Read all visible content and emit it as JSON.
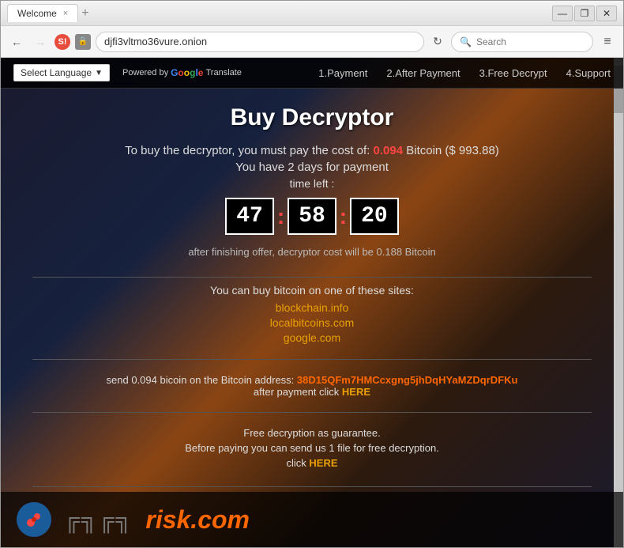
{
  "window": {
    "title": "Welcome",
    "tab_close": "×",
    "tab_new": "+",
    "url": "djfi3vltmo36vure.onion",
    "btn_min": "—",
    "btn_restore": "❐",
    "btn_close": "✕",
    "menu_icon": "≡"
  },
  "search": {
    "placeholder": "Search"
  },
  "nav": {
    "language_label": "Select Language",
    "powered_text": "Powered by",
    "translate_text": "Translate",
    "links": [
      {
        "label": "1.Payment"
      },
      {
        "label": "2.After Payment"
      },
      {
        "label": "3.Free Decrypt"
      },
      {
        "label": "4.Support"
      }
    ]
  },
  "main": {
    "title": "Buy Decryptor",
    "price_text_before": "To buy the decryptor, you must pay the cost of:",
    "price_value": "0.094",
    "price_usd": "Bitcoin ($ 993.88)",
    "days_text": "You have 2 days for payment",
    "time_left_label": "time left :",
    "timer": {
      "hours": "47",
      "minutes": "58",
      "seconds": "20"
    },
    "after_offer": "after finishing offer, decryptor cost will be 0.188 Bitcoin",
    "buy_sites_title": "You can buy bitcoin on one of these sites:",
    "sites": [
      {
        "label": "blockchain.info"
      },
      {
        "label": "localbitcoins.com"
      },
      {
        "label": "google.com"
      }
    ],
    "send_text": "send 0.094 bicoin on the Bitcoin address:",
    "bitcoin_address": "38D15QFm7HMCcxgng5jhDqHYaMZDqrDFKu",
    "after_payment_text": "after payment click",
    "here_link": "HERE",
    "free_title": "Free decryption as guarantee.",
    "free_subtitle": "Before paying you can send us 1 file for free decryption.",
    "free_click": "click",
    "free_here": "HERE"
  },
  "watermark": {
    "text": "risk.com"
  }
}
